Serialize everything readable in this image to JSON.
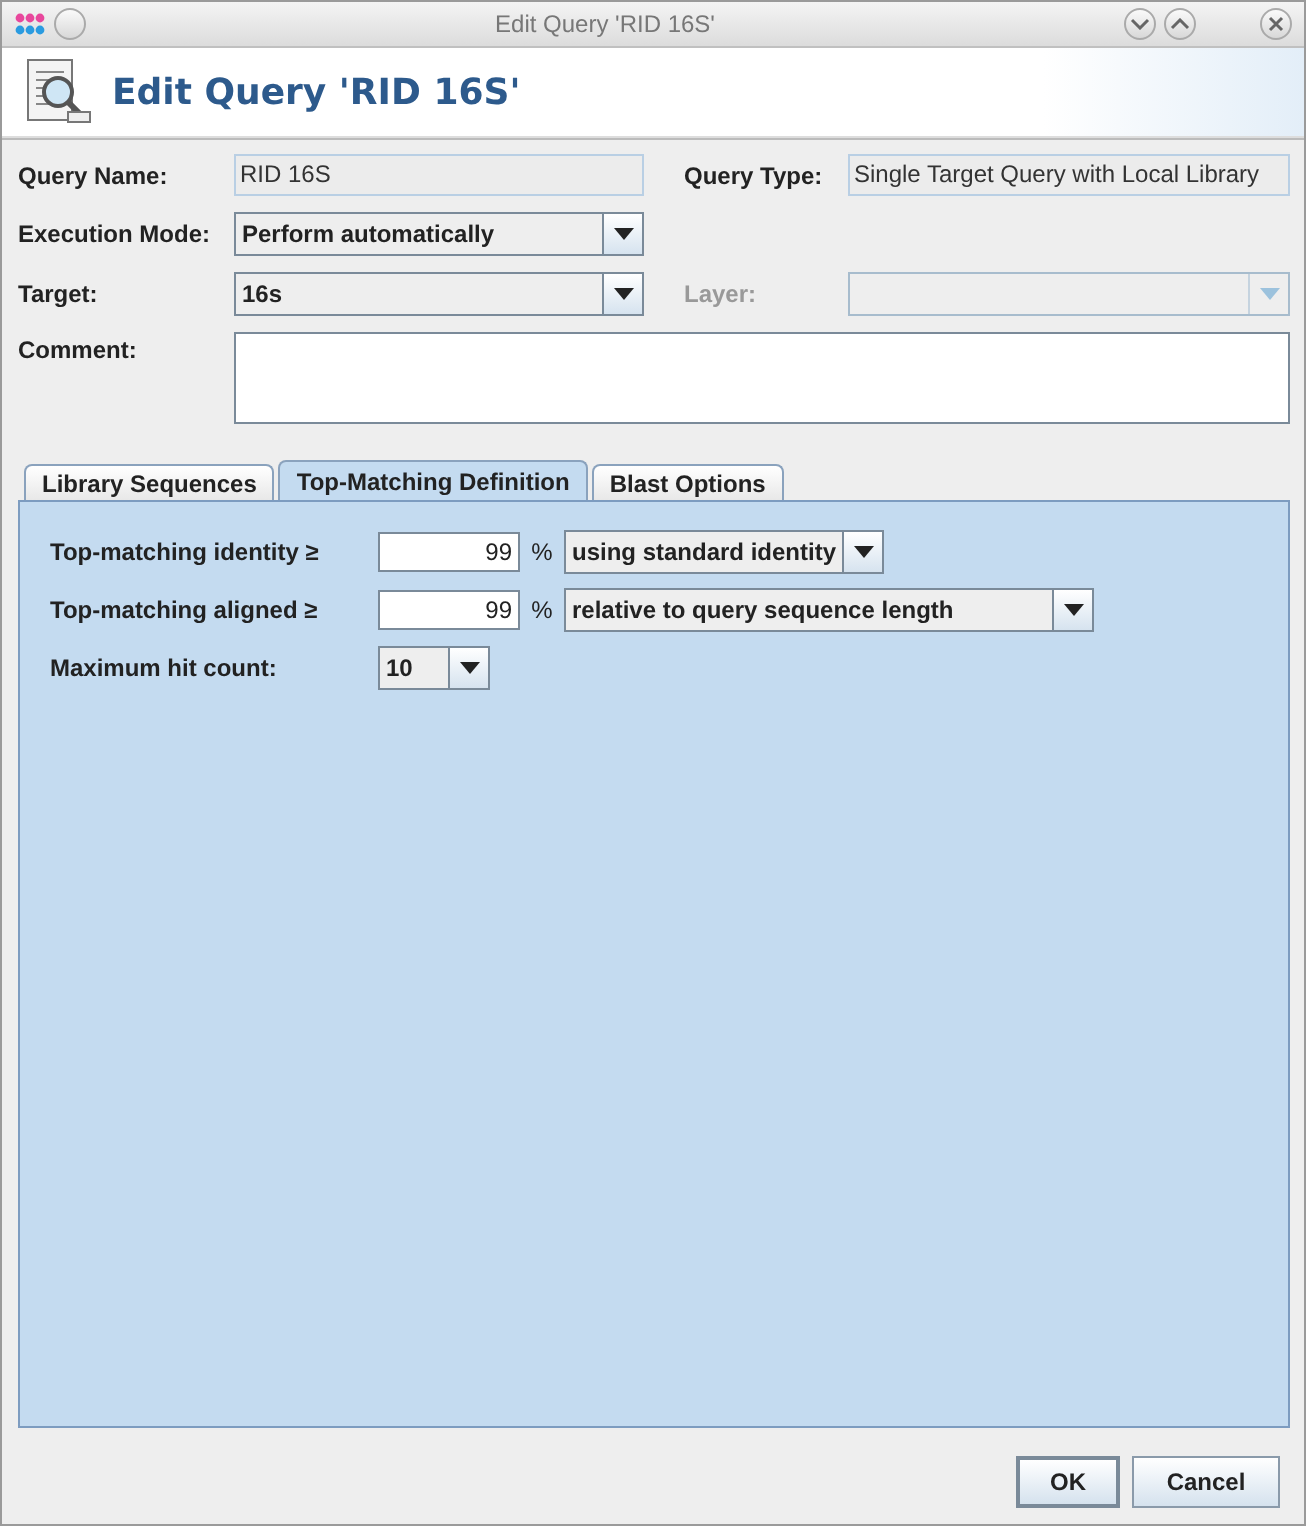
{
  "window": {
    "title": "Edit Query 'RID 16S'"
  },
  "header": {
    "title": "Edit Query 'RID 16S'"
  },
  "fields": [
    {
      "label": "Query Name:",
      "kind": "readonly",
      "value": "RID 16S"
    },
    {
      "label": "Query Type:",
      "kind": "readonly",
      "value": "Single Target Query with Local Library"
    },
    {
      "label": "Execution Mode:",
      "kind": "combo",
      "value": "Perform automatically"
    },
    {
      "label": "Target:",
      "kind": "combo",
      "value": "16s"
    },
    {
      "label": "Layer:",
      "kind": "combo",
      "disabled": true
    },
    {
      "label": "Comment:",
      "kind": "textarea"
    }
  ],
  "tabs": [
    {
      "label": "Library Sequences",
      "selected": false
    },
    {
      "label": "Top-Matching Definition",
      "selected": true
    },
    {
      "label": "Blast Options",
      "selected": false
    }
  ],
  "settings": [
    {
      "label": "Top-matching identity ≥",
      "value": "99",
      "unit": "%",
      "option": "using standard identity"
    },
    {
      "label": "Top-matching aligned ≥",
      "value": "99",
      "unit": "%",
      "option": "relative to query sequence length"
    },
    {
      "label": "Maximum hit count:",
      "option": "10"
    }
  ],
  "buttons": [
    "OK",
    "Cancel"
  ]
}
